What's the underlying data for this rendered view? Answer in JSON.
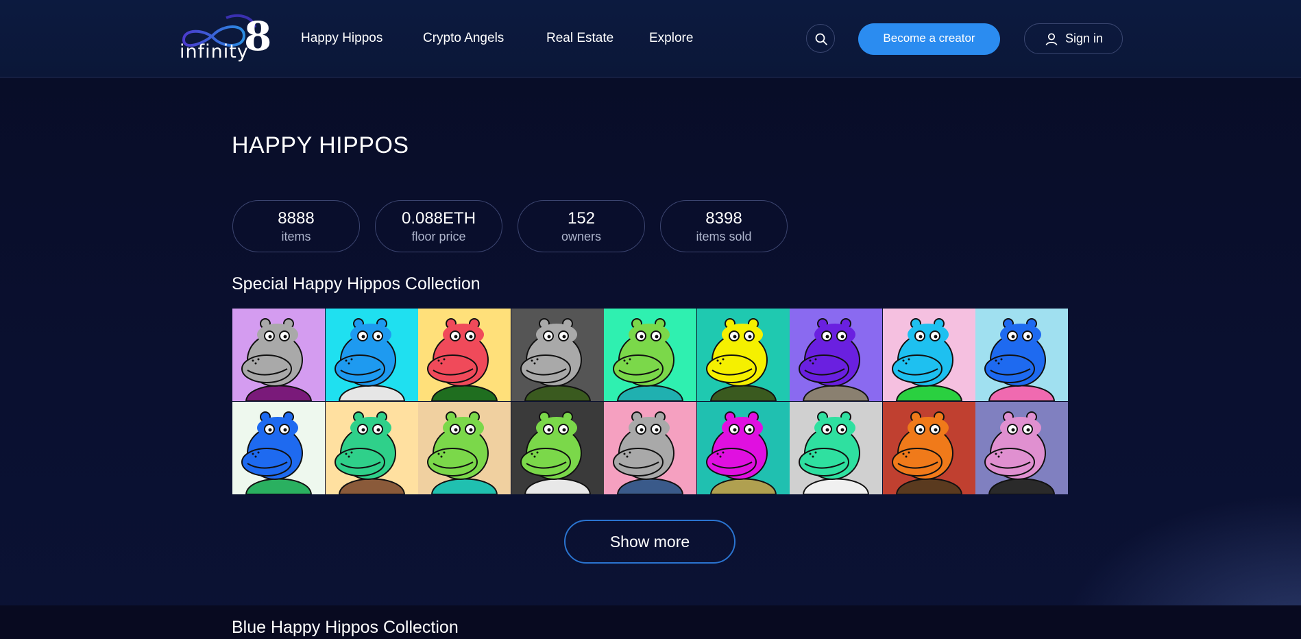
{
  "header": {
    "logo": {
      "text": "infinity",
      "mark": "8"
    },
    "nav": [
      {
        "label": "Happy Hippos"
      },
      {
        "label": "Crypto Angels"
      },
      {
        "label": "Real Estate"
      },
      {
        "label": "Explore"
      }
    ],
    "search_icon": "search-icon",
    "become_creator_label": "Become a creator",
    "sign_in_label": "Sign in",
    "sign_in_icon": "user-icon",
    "accent_color": "#2b8cf0"
  },
  "main": {
    "title": "HAPPY HIPPOS",
    "stats": [
      {
        "value": "8888",
        "label": "items"
      },
      {
        "value": "0.088ETH",
        "label": "floor price"
      },
      {
        "value": "152",
        "label": "owners"
      },
      {
        "value": "8398",
        "label": "items sold"
      }
    ],
    "special_collection": {
      "title": "Special Happy Hippos Collection",
      "tiles": [
        {
          "bg": "#d49cf0",
          "skin": "#a9a9a9",
          "shirt": "#7a1a7a"
        },
        {
          "bg": "#1fe0f0",
          "skin": "#1e9af0",
          "shirt": "#e6e6e6"
        },
        {
          "bg": "#ffe07a",
          "skin": "#f04a5a",
          "shirt": "#1f6e1f"
        },
        {
          "bg": "#555555",
          "skin": "#a9a9a9",
          "shirt": "#3a5a1f"
        },
        {
          "bg": "#2ff0b0",
          "skin": "#7bd84a",
          "shirt": "#20b0b0"
        },
        {
          "bg": "#1fc9b0",
          "skin": "#f5f000",
          "shirt": "#3a5a1f"
        },
        {
          "bg": "#8a6af0",
          "skin": "#6a20e0",
          "shirt": "#8a8070"
        },
        {
          "bg": "#f5c0e0",
          "skin": "#1ec0f0",
          "shirt": "#2ad040"
        },
        {
          "bg": "#a0e0f0",
          "skin": "#1e6af0",
          "shirt": "#f06ab0"
        },
        {
          "bg": "#eef8ee",
          "skin": "#1e6af0",
          "shirt": "#2ab060"
        },
        {
          "bg": "#ffe0a0",
          "skin": "#2fd08a",
          "shirt": "#8a5a3a"
        },
        {
          "bg": "#f0d0a0",
          "skin": "#7bd84a",
          "shirt": "#20c0b0"
        },
        {
          "bg": "#3a3a3a",
          "skin": "#7bd84a",
          "shirt": "#e8e8e8"
        },
        {
          "bg": "#f5a0c0",
          "skin": "#a9a9a9",
          "shirt": "#3a5a8a"
        },
        {
          "bg": "#20c0b0",
          "skin": "#e010e0",
          "shirt": "#b0a050"
        },
        {
          "bg": "#d0d0d0",
          "skin": "#2fe0a0",
          "shirt": "#f0f0f0"
        },
        {
          "bg": "#c04030",
          "skin": "#f07a1a",
          "shirt": "#5a3a1f"
        },
        {
          "bg": "#8080c0",
          "skin": "#e090d0",
          "shirt": "#2a2a2a"
        }
      ]
    },
    "show_more_label": "Show more",
    "blue_collection": {
      "title": "Blue Happy Hippos Collection"
    }
  }
}
